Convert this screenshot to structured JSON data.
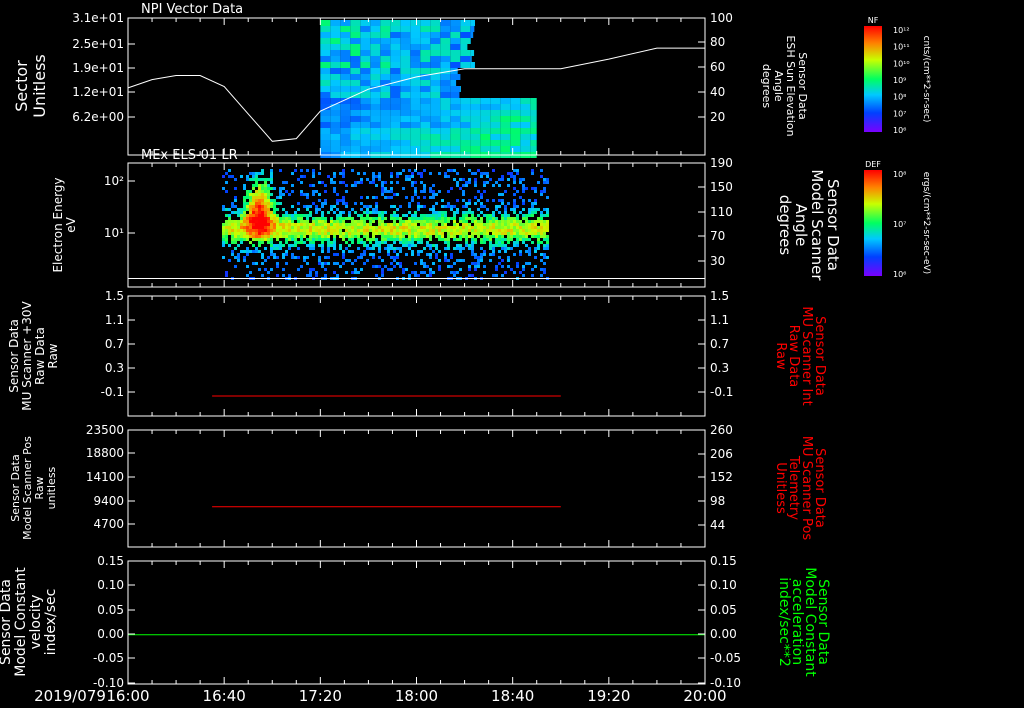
{
  "date_label": "2019/079",
  "x_ticks": [
    "16:00",
    "16:40",
    "17:20",
    "18:00",
    "18:40",
    "19:20",
    "20:00"
  ],
  "colors": {
    "background": "#000000",
    "axis": "#ffffff",
    "red_trace": "#ff0000",
    "green_trace": "#00ff00"
  },
  "colorbars": [
    {
      "tag": "NF",
      "ticks": [
        "10¹²",
        "10¹¹",
        "10¹⁰",
        "10⁹",
        "10⁸",
        "10⁷",
        "10⁶"
      ],
      "units": "cnts/(cm**2-sr-sec)"
    },
    {
      "tag": "DEF",
      "ticks": [
        "10⁸",
        "10⁷",
        "10⁶"
      ],
      "units": "ergs/(cm**2-sr-sec-eV)"
    }
  ],
  "chart_data": [
    {
      "type": "heatmap",
      "title": "NPI Vector Data",
      "left_label": [
        "Sector",
        "Unitless"
      ],
      "right_label": [
        "Sensor Data",
        "ESH Sun Elevation",
        "Angle",
        "degrees"
      ],
      "y_ticks_left": [
        "3.1e+01",
        "2.5e+01",
        "1.9e+01",
        "1.2e+01",
        "6.2e+00"
      ],
      "y_ticks_right": [
        "100",
        "80",
        "60",
        "40",
        "20"
      ],
      "y_range_right": [
        0,
        100
      ],
      "spectrogram_time": [
        "17:20",
        "18:50"
      ],
      "line_series": {
        "name": "ESH Sun Elevation Angle",
        "color": "#ffffff",
        "time": [
          "16:00",
          "16:10",
          "16:20",
          "16:30",
          "16:40",
          "16:50",
          "17:00",
          "17:10",
          "17:20",
          "17:40",
          "18:00",
          "18:20",
          "18:40",
          "19:00",
          "19:20",
          "19:40",
          "20:00"
        ],
        "values": [
          49,
          55,
          58,
          58,
          50,
          30,
          10,
          12,
          32,
          48,
          57,
          63,
          63,
          63,
          70,
          78,
          78
        ]
      }
    },
    {
      "type": "heatmap",
      "title": "MEx ELS-01 LR",
      "left_label": [
        "Electron Energy",
        "eV"
      ],
      "right_label": [
        "Sensor Data",
        "Model Scanner",
        "Angle",
        "degrees"
      ],
      "y_ticks_left": [
        "10²",
        "10¹"
      ],
      "y_ticks_right": [
        "190",
        "150",
        "110",
        "70",
        "30"
      ],
      "y_range_right": [
        0,
        190
      ],
      "spectrogram_time": [
        "16:35",
        "18:50"
      ],
      "line_series": {
        "name": "Model Scanner Angle",
        "color": "#ffffff",
        "time": [
          "16:00",
          "20:00"
        ],
        "values": [
          13,
          13
        ]
      }
    },
    {
      "type": "line",
      "left_label": [
        "Sensor Data",
        "MU Scanner +30V",
        "Raw Data",
        "Raw"
      ],
      "right_label": [
        "Sensor Data",
        "MU Scanner Int",
        "Raw Data",
        "Raw"
      ],
      "y_ticks_left": [
        "1.5",
        "1.1",
        "0.7",
        "0.3",
        "-0.1"
      ],
      "y_ticks_right": [
        "1.5",
        "1.1",
        "0.7",
        "0.3",
        "-0.1"
      ],
      "ylim": [
        -0.3,
        1.5
      ],
      "series": [
        {
          "color": "#ff0000",
          "time": [
            "16:35",
            "19:00"
          ],
          "values": [
            0.0,
            0.0
          ]
        }
      ]
    },
    {
      "type": "line",
      "left_label": [
        "Sensor Data",
        "Model Scanner Pos",
        "Raw",
        "unitless"
      ],
      "right_label": [
        "Sensor Data",
        "MU Scanner Pos",
        "Telemetry",
        "Unitless"
      ],
      "y_ticks_left": [
        "23500",
        "18800",
        "14100",
        "9400",
        "4700"
      ],
      "y_ticks_right": [
        "260",
        "206",
        "152",
        "98",
        "44"
      ],
      "ylim": [
        0,
        23500
      ],
      "series": [
        {
          "color": "#ff0000",
          "time": [
            "16:35",
            "19:00"
          ],
          "values": [
            8100,
            8100
          ]
        }
      ]
    },
    {
      "type": "line",
      "left_label": [
        "Sensor Data",
        "Model Constant",
        "velocity",
        "index/sec"
      ],
      "right_label": [
        "Sensor Data",
        "Model Constant",
        "acceleration",
        "index/sec**2"
      ],
      "y_ticks_left": [
        "0.15",
        "0.10",
        "0.05",
        "0.00",
        "-0.05",
        "-0.10"
      ],
      "y_ticks_right": [
        "0.15",
        "0.10",
        "0.05",
        "0.00",
        "-0.05",
        "-0.10"
      ],
      "ylim": [
        -0.1,
        0.15
      ],
      "series": [
        {
          "color": "#00ff00",
          "time": [
            "16:00",
            "20:00"
          ],
          "values": [
            0.0,
            0.0
          ]
        }
      ]
    }
  ]
}
